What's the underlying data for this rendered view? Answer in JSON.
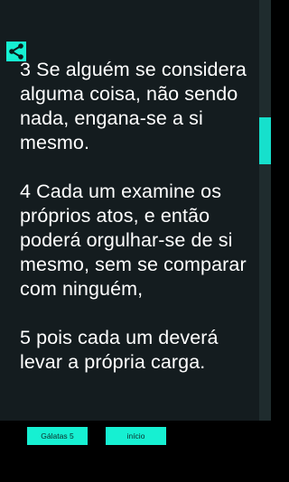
{
  "header": {
    "share_icon": "share-icon"
  },
  "verses": [
    "3 Se alguém se considera alguma coisa, não sendo nada, engana-se a si mesmo.",
    "4 Cada um examine os próprios atos, e então poderá orgulhar-se de si mesmo, sem se comparar com ninguém,",
    "5 pois cada um deverá levar a própria carga."
  ],
  "scroll": {
    "position_fraction": 0.28
  },
  "buttons": {
    "chapter_label": "Gálatas 5",
    "home_label": "início"
  },
  "colors": {
    "accent": "#16f0d2",
    "background": "#141c1f",
    "text": "#ffffff"
  }
}
